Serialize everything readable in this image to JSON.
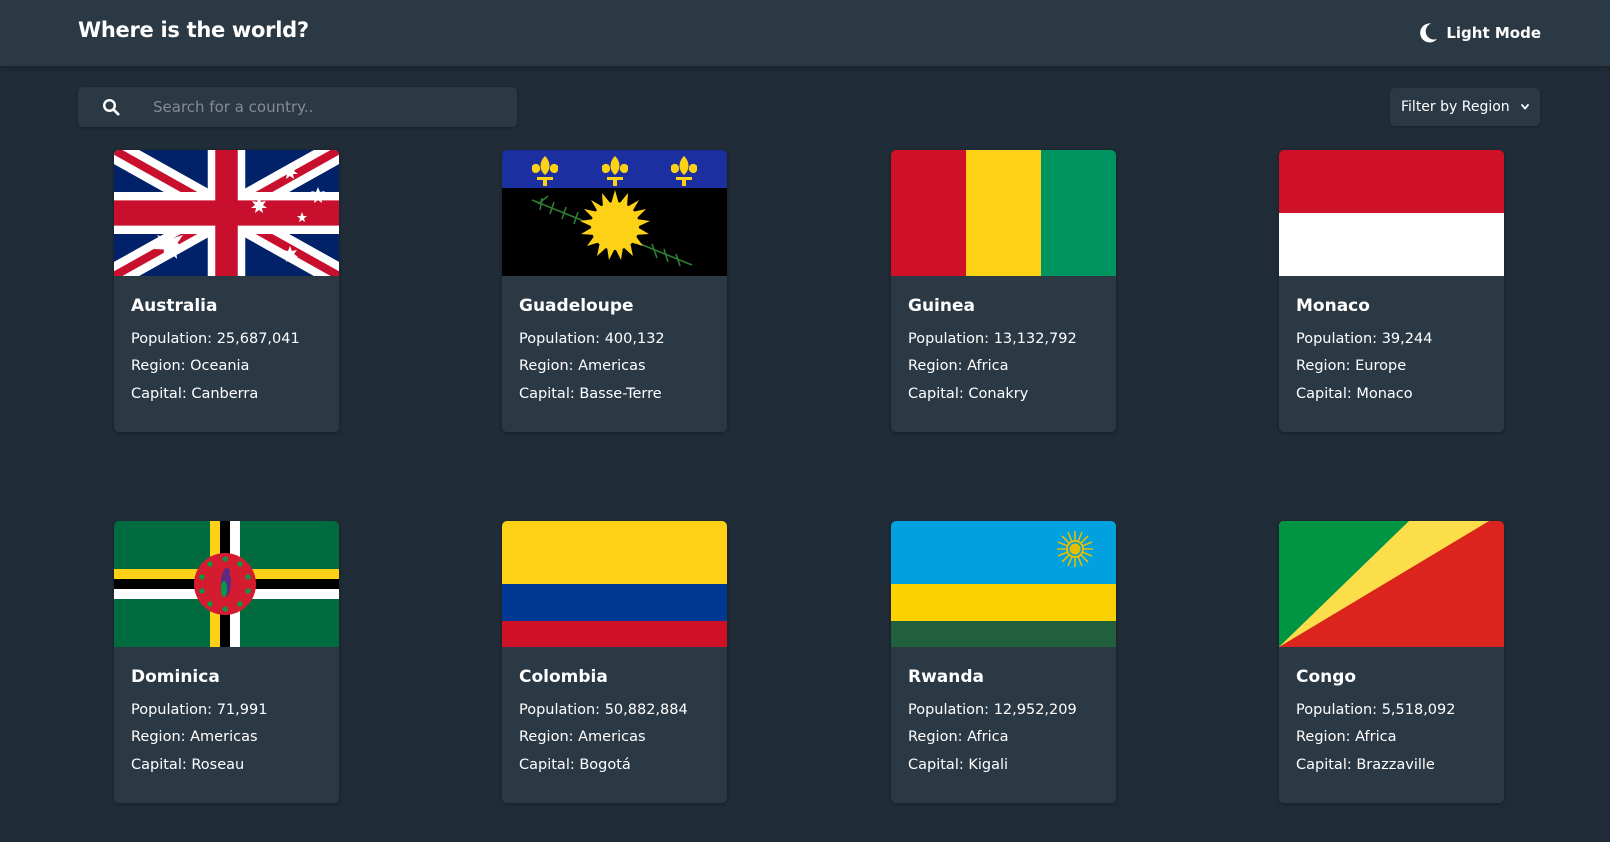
{
  "header": {
    "title": "Where is the world?",
    "mode_label": "Light Mode",
    "mode_icon": "moon-icon"
  },
  "search": {
    "placeholder": "Search for a country..",
    "value": "",
    "icon": "search-icon"
  },
  "filter": {
    "label": "Filter by Region",
    "icon": "chevron-down-icon"
  },
  "labels": {
    "population": "Population:",
    "region": "Region:",
    "capital": "Capital:"
  },
  "countries": [
    {
      "name": "Australia",
      "population": "25,687,041",
      "region": "Oceania",
      "capital": "Canberra",
      "flag": "australia-flag"
    },
    {
      "name": "Guadeloupe",
      "population": "400,132",
      "region": "Americas",
      "capital": "Basse-Terre",
      "flag": "guadeloupe-flag"
    },
    {
      "name": "Guinea",
      "population": "13,132,792",
      "region": "Africa",
      "capital": "Conakry",
      "flag": "guinea-flag"
    },
    {
      "name": "Monaco",
      "population": "39,244",
      "region": "Europe",
      "capital": "Monaco",
      "flag": "monaco-flag"
    },
    {
      "name": "Dominica",
      "population": "71,991",
      "region": "Americas",
      "capital": "Roseau",
      "flag": "dominica-flag"
    },
    {
      "name": "Colombia",
      "population": "50,882,884",
      "region": "Americas",
      "capital": "Bogotá",
      "flag": "colombia-flag"
    },
    {
      "name": "Rwanda",
      "population": "12,952,209",
      "region": "Africa",
      "capital": "Kigali",
      "flag": "rwanda-flag"
    },
    {
      "name": "Congo",
      "population": "5,518,092",
      "region": "Africa",
      "capital": "Brazzaville",
      "flag": "congo-flag"
    }
  ],
  "colors": {
    "background": "#202c37",
    "elements": "#2b3945",
    "text": "#ffffff",
    "placeholder": "#858a90"
  }
}
